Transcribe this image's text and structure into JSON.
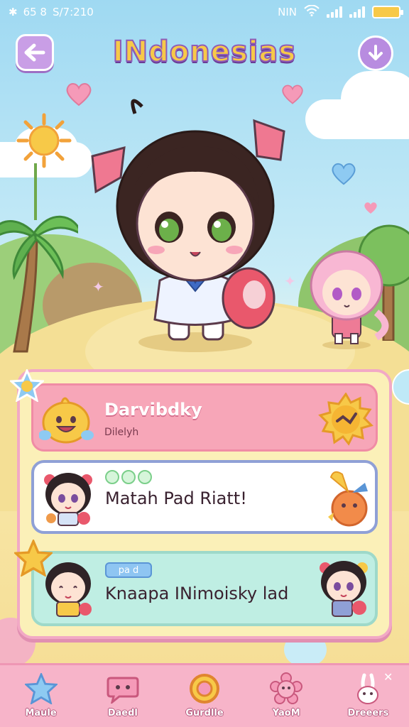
{
  "status_bar": {
    "left_text": "65 8",
    "time": "S/7:210",
    "carrier": "NIN"
  },
  "header": {
    "title": "INdonesias"
  },
  "cards": [
    {
      "title": "Darvibdky",
      "subtitle": "Dilelyh"
    },
    {
      "title": "Matah Pad Riatt!"
    },
    {
      "tag": "pa d",
      "title": "Knaapa INimoisky lad"
    }
  ],
  "nav": [
    {
      "label": "Maule",
      "icon": "star-icon"
    },
    {
      "label": "Daedl",
      "icon": "chat-bubble-icon"
    },
    {
      "label": "Gurdlle",
      "icon": "coin-icon"
    },
    {
      "label": "YaoM",
      "icon": "flower-face-icon"
    },
    {
      "label": "Dreeers",
      "icon": "bunny-icon"
    }
  ],
  "colors": {
    "panel_border": "#f2a9c5",
    "nav_bg": "#f7b4c9",
    "title_fill": "#f7c948",
    "title_stroke": "#8e5bb8"
  }
}
